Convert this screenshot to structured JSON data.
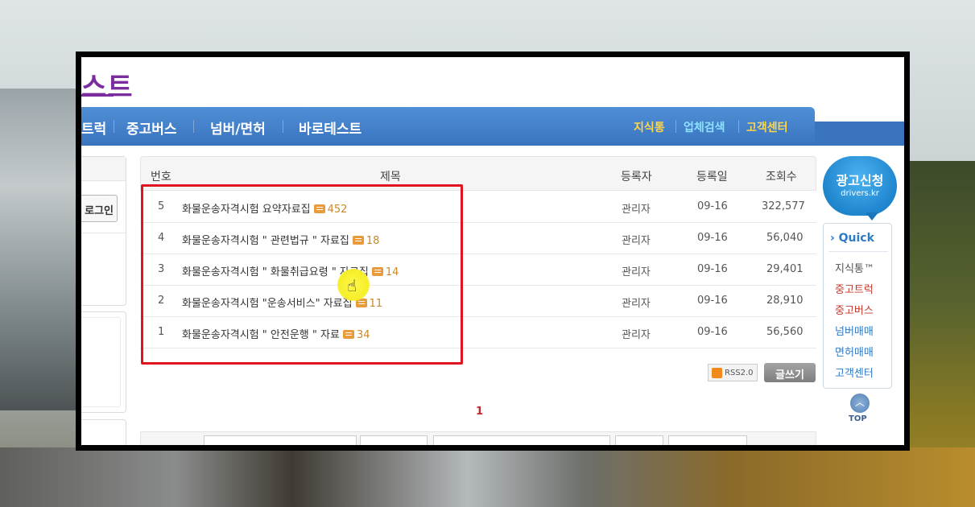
{
  "site": {
    "logo_text": "스트"
  },
  "nav": {
    "items": [
      "트럭",
      "중고버스",
      "넘버/면허",
      "바로테스트"
    ],
    "right_links": [
      "지식통",
      "업체검색",
      "고객센터"
    ]
  },
  "sidebar": {
    "login_label": "로그인"
  },
  "board": {
    "headers": {
      "no": "번호",
      "title": "제목",
      "author": "등록자",
      "date": "등록일",
      "views": "조회수"
    },
    "rows": [
      {
        "no": "5",
        "title": "화물운송자격시험 요약자료집",
        "comments": "452",
        "author": "관리자",
        "date": "09-16",
        "views": "322,577"
      },
      {
        "no": "4",
        "title": "화물운송자격시험 \" 관련법규 \" 자료집",
        "comments": "18",
        "author": "관리자",
        "date": "09-16",
        "views": "56,040"
      },
      {
        "no": "3",
        "title": "화물운송자격시험 \" 화물취급요령 \" 자료집",
        "comments": "14",
        "author": "관리자",
        "date": "09-16",
        "views": "29,401"
      },
      {
        "no": "2",
        "title": "화물운송자격시험 \"운송서비스\" 자료집",
        "comments": "11",
        "author": "관리자",
        "date": "09-16",
        "views": "28,910"
      },
      {
        "no": "1",
        "title": "화물운송자격시험 \" 안전운행 \" 자료",
        "comments": "34",
        "author": "관리자",
        "date": "09-16",
        "views": "56,560"
      }
    ],
    "rss_label": "RSS2.0",
    "write_label": "글쓰기",
    "current_page": "1"
  },
  "ad": {
    "title": "광고신청",
    "subtitle": "drivers.kr"
  },
  "quick": {
    "title": "› Quick",
    "items": [
      {
        "label": "지식통™",
        "color": "#555555"
      },
      {
        "label": "중고트럭",
        "color": "#c0392b"
      },
      {
        "label": "중고버스",
        "color": "#c0392b"
      },
      {
        "label": "넘버매매",
        "color": "#2d7ac5"
      },
      {
        "label": "면허매매",
        "color": "#2d7ac5"
      },
      {
        "label": "고객센터",
        "color": "#2d7ac5"
      }
    ]
  },
  "top_button": {
    "label": "TOP"
  },
  "colors": {
    "nav_blue": "#3a74bf",
    "highlight_red": "#e0141e",
    "logo_purple": "#7b2c9e"
  }
}
